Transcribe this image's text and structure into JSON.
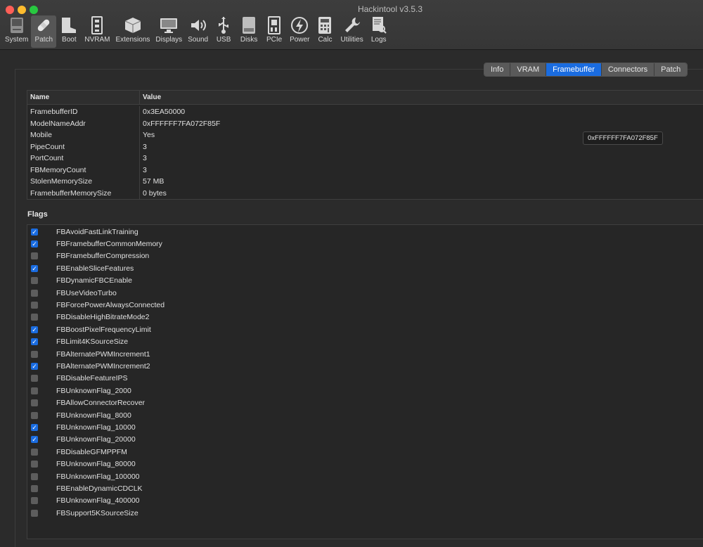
{
  "window": {
    "title": "Hackintool v3.5.3"
  },
  "toolbar": {
    "items": [
      {
        "label": "System",
        "icon": "system-icon"
      },
      {
        "label": "Patch",
        "icon": "patch-icon",
        "active": true
      },
      {
        "label": "Boot",
        "icon": "boot-icon"
      },
      {
        "label": "NVRAM",
        "icon": "nvram-icon"
      },
      {
        "label": "Extensions",
        "icon": "extensions-icon"
      },
      {
        "label": "Displays",
        "icon": "displays-icon"
      },
      {
        "label": "Sound",
        "icon": "sound-icon"
      },
      {
        "label": "USB",
        "icon": "usb-icon"
      },
      {
        "label": "Disks",
        "icon": "disks-icon"
      },
      {
        "label": "PCIe",
        "icon": "pcie-icon"
      },
      {
        "label": "Power",
        "icon": "power-icon"
      },
      {
        "label": "Calc",
        "icon": "calc-icon"
      },
      {
        "label": "Utilities",
        "icon": "utilities-icon"
      },
      {
        "label": "Logs",
        "icon": "logs-icon"
      }
    ]
  },
  "tabs": [
    "Info",
    "VRAM",
    "Framebuffer",
    "Connectors",
    "Patch"
  ],
  "selected_tab": "Framebuffer",
  "info_table": {
    "headers": {
      "name": "Name",
      "value": "Value"
    },
    "rows": [
      {
        "name": "FramebufferID",
        "value": "0x3EA50000"
      },
      {
        "name": "ModelNameAddr",
        "value": "0xFFFFFF7FA072F85F"
      },
      {
        "name": "Mobile",
        "value": "Yes"
      },
      {
        "name": "PipeCount",
        "value": "3"
      },
      {
        "name": "PortCount",
        "value": "3"
      },
      {
        "name": "FBMemoryCount",
        "value": "3"
      },
      {
        "name": "StolenMemorySize",
        "value": "57 MB"
      },
      {
        "name": "FramebufferMemorySize",
        "value": "0 bytes"
      }
    ]
  },
  "tooltip": {
    "text": "0xFFFFFF7FA072F85F"
  },
  "flags": {
    "title": "Flags",
    "items": [
      {
        "label": "FBAvoidFastLinkTraining",
        "checked": true
      },
      {
        "label": "FBFramebufferCommonMemory",
        "checked": true
      },
      {
        "label": "FBFramebufferCompression",
        "checked": false
      },
      {
        "label": "FBEnableSliceFeatures",
        "checked": true
      },
      {
        "label": "FBDynamicFBCEnable",
        "checked": false
      },
      {
        "label": "FBUseVideoTurbo",
        "checked": false
      },
      {
        "label": "FBForcePowerAlwaysConnected",
        "checked": false
      },
      {
        "label": "FBDisableHighBitrateMode2",
        "checked": false
      },
      {
        "label": "FBBoostPixelFrequencyLimit",
        "checked": true
      },
      {
        "label": "FBLimit4KSourceSize",
        "checked": true
      },
      {
        "label": "FBAlternatePWMIncrement1",
        "checked": false
      },
      {
        "label": "FBAlternatePWMIncrement2",
        "checked": true
      },
      {
        "label": "FBDisableFeatureIPS",
        "checked": false
      },
      {
        "label": "FBUnknownFlag_2000",
        "checked": false
      },
      {
        "label": "FBAllowConnectorRecover",
        "checked": false
      },
      {
        "label": "FBUnknownFlag_8000",
        "checked": false
      },
      {
        "label": "FBUnknownFlag_10000",
        "checked": true
      },
      {
        "label": "FBUnknownFlag_20000",
        "checked": true
      },
      {
        "label": "FBDisableGFMPPFM",
        "checked": false
      },
      {
        "label": "FBUnknownFlag_80000",
        "checked": false
      },
      {
        "label": "FBUnknownFlag_100000",
        "checked": false
      },
      {
        "label": "FBEnableDynamicCDCLK",
        "checked": false
      },
      {
        "label": "FBUnknownFlag_400000",
        "checked": false
      },
      {
        "label": "FBSupport5KSourceSize",
        "checked": false
      }
    ]
  },
  "colors": {
    "accent": "#1a6ce0",
    "background": "#2b2b2b"
  }
}
